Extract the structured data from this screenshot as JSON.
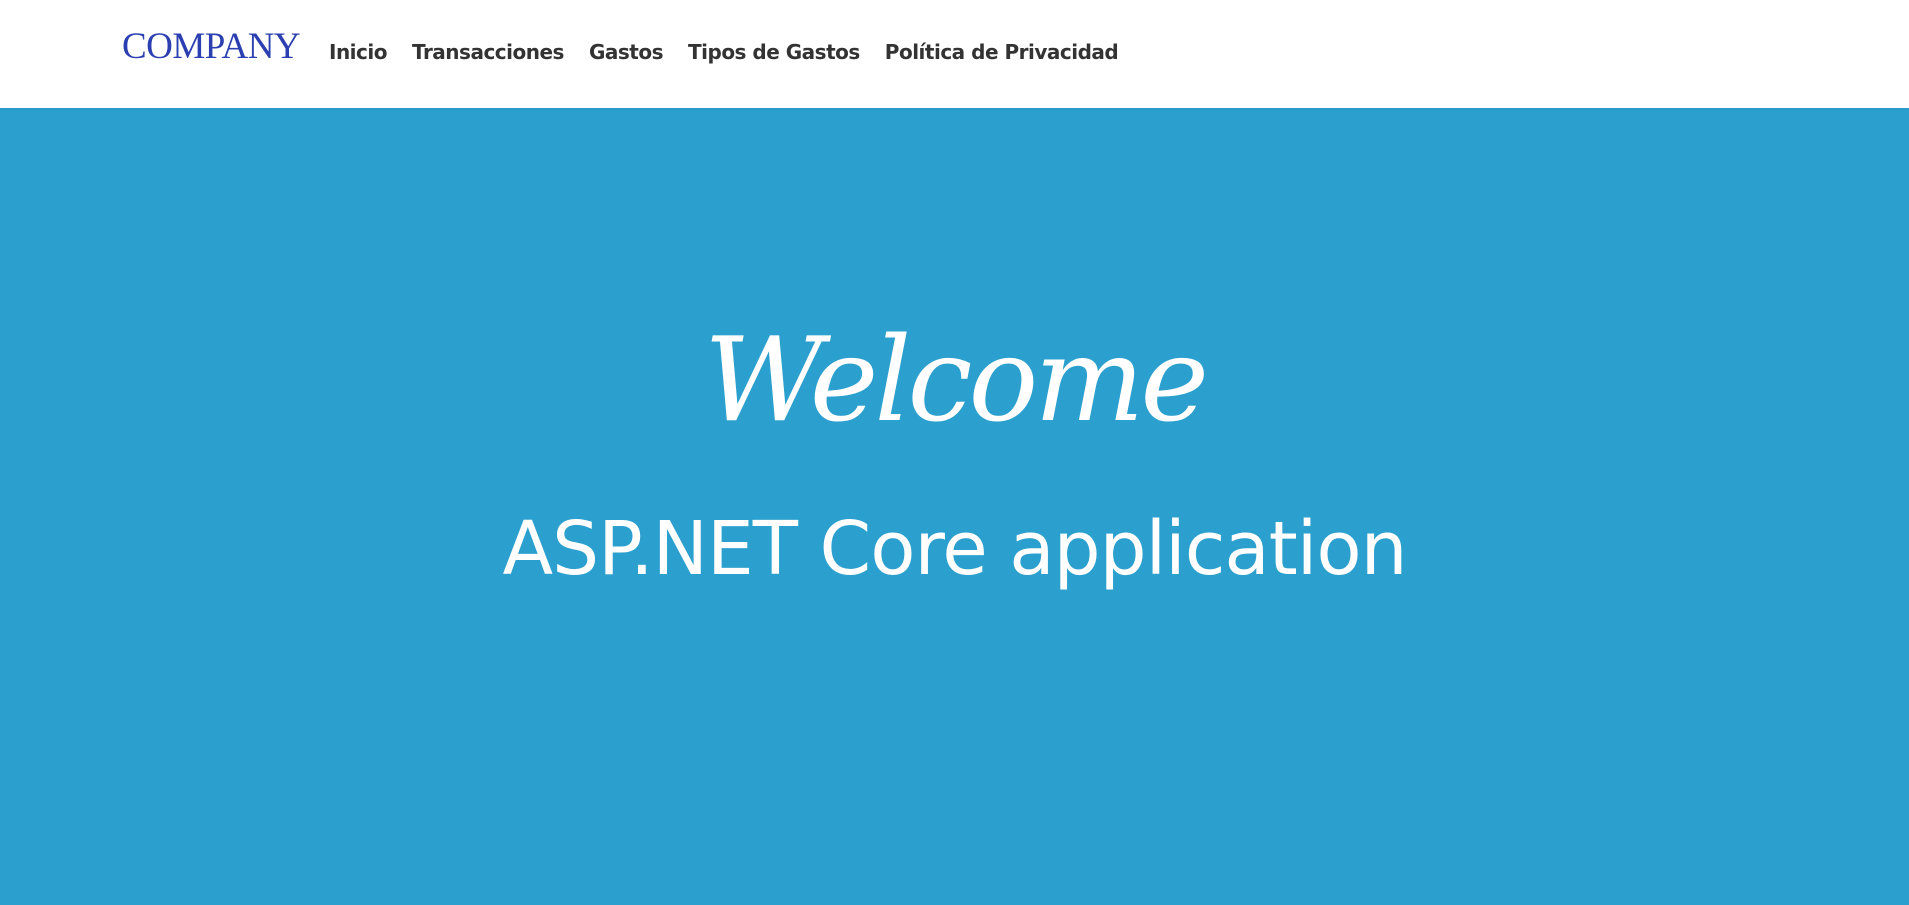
{
  "header": {
    "brand": "COMPANY",
    "nav": [
      {
        "label": "Inicio"
      },
      {
        "label": "Transacciones"
      },
      {
        "label": "Gastos"
      },
      {
        "label": "Tipos de Gastos"
      },
      {
        "label": "Política de Privacidad"
      }
    ]
  },
  "hero": {
    "title": "Welcome",
    "subtitle": "ASP.NET Core application"
  },
  "colors": {
    "brand": "#2b3fb0",
    "hero_background": "#2ba0cf",
    "nav_text": "#333333",
    "hero_text": "#ffffff"
  }
}
